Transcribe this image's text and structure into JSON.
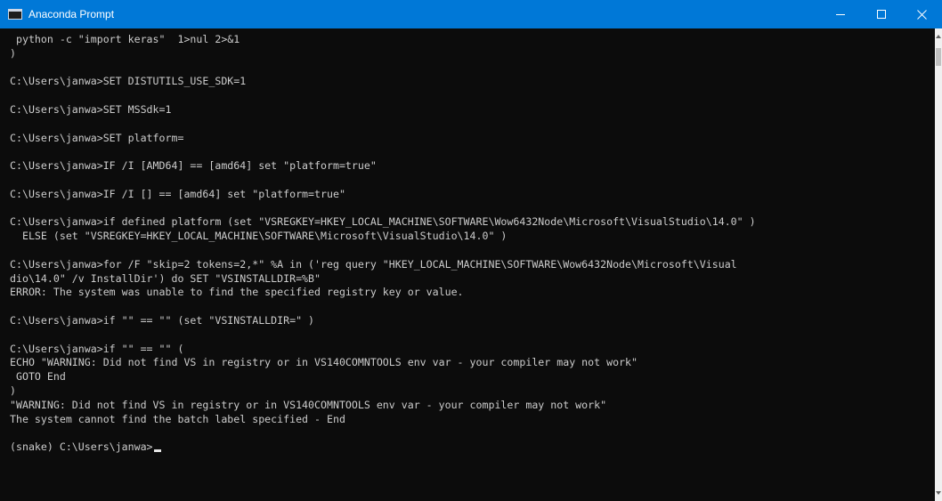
{
  "window": {
    "title": "Anaconda Prompt",
    "titlebar_color": "#0078d7",
    "console_background": "#0c0c0c",
    "console_foreground": "#cccccc",
    "controls": {
      "minimize_icon": "minimize-icon",
      "maximize_icon": "maximize-icon",
      "close_icon": "close-icon"
    }
  },
  "console": {
    "lines": [
      " python -c \"import keras\"  1>nul 2>&1",
      ")",
      "",
      "C:\\Users\\janwa>SET DISTUTILS_USE_SDK=1",
      "",
      "C:\\Users\\janwa>SET MSSdk=1",
      "",
      "C:\\Users\\janwa>SET platform=",
      "",
      "C:\\Users\\janwa>IF /I [AMD64] == [amd64] set \"platform=true\"",
      "",
      "C:\\Users\\janwa>IF /I [] == [amd64] set \"platform=true\"",
      "",
      "C:\\Users\\janwa>if defined platform (set \"VSREGKEY=HKEY_LOCAL_MACHINE\\SOFTWARE\\Wow6432Node\\Microsoft\\VisualStudio\\14.0\" )",
      "  ELSE (set \"VSREGKEY=HKEY_LOCAL_MACHINE\\SOFTWARE\\Microsoft\\VisualStudio\\14.0\" )",
      "",
      "C:\\Users\\janwa>for /F \"skip=2 tokens=2,*\" %A in ('reg query \"HKEY_LOCAL_MACHINE\\SOFTWARE\\Wow6432Node\\Microsoft\\Visual",
      "dio\\14.0\" /v InstallDir') do SET \"VSINSTALLDIR=%B\"",
      "ERROR: The system was unable to find the specified registry key or value.",
      "",
      "C:\\Users\\janwa>if \"\" == \"\" (set \"VSINSTALLDIR=\" )",
      "",
      "C:\\Users\\janwa>if \"\" == \"\" (",
      "ECHO \"WARNING: Did not find VS in registry or in VS140COMNTOOLS env var - your compiler may not work\"",
      " GOTO End",
      ")",
      "\"WARNING: Did not find VS in registry or in VS140COMNTOOLS env var - your compiler may not work\"",
      "The system cannot find the batch label specified - End",
      ""
    ],
    "prompt": "(snake) C:\\Users\\janwa>"
  }
}
